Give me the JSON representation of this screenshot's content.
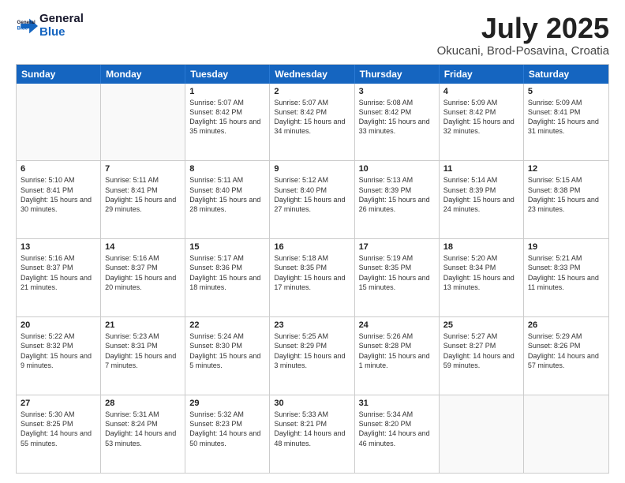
{
  "logo": {
    "text_general": "General",
    "text_blue": "Blue"
  },
  "title": "July 2025",
  "subtitle": "Okucani, Brod-Posavina, Croatia",
  "calendar": {
    "headers": [
      "Sunday",
      "Monday",
      "Tuesday",
      "Wednesday",
      "Thursday",
      "Friday",
      "Saturday"
    ],
    "weeks": [
      [
        {
          "day": "",
          "info": ""
        },
        {
          "day": "",
          "info": ""
        },
        {
          "day": "1",
          "info": "Sunrise: 5:07 AM\nSunset: 8:42 PM\nDaylight: 15 hours and 35 minutes."
        },
        {
          "day": "2",
          "info": "Sunrise: 5:07 AM\nSunset: 8:42 PM\nDaylight: 15 hours and 34 minutes."
        },
        {
          "day": "3",
          "info": "Sunrise: 5:08 AM\nSunset: 8:42 PM\nDaylight: 15 hours and 33 minutes."
        },
        {
          "day": "4",
          "info": "Sunrise: 5:09 AM\nSunset: 8:42 PM\nDaylight: 15 hours and 32 minutes."
        },
        {
          "day": "5",
          "info": "Sunrise: 5:09 AM\nSunset: 8:41 PM\nDaylight: 15 hours and 31 minutes."
        }
      ],
      [
        {
          "day": "6",
          "info": "Sunrise: 5:10 AM\nSunset: 8:41 PM\nDaylight: 15 hours and 30 minutes."
        },
        {
          "day": "7",
          "info": "Sunrise: 5:11 AM\nSunset: 8:41 PM\nDaylight: 15 hours and 29 minutes."
        },
        {
          "day": "8",
          "info": "Sunrise: 5:11 AM\nSunset: 8:40 PM\nDaylight: 15 hours and 28 minutes."
        },
        {
          "day": "9",
          "info": "Sunrise: 5:12 AM\nSunset: 8:40 PM\nDaylight: 15 hours and 27 minutes."
        },
        {
          "day": "10",
          "info": "Sunrise: 5:13 AM\nSunset: 8:39 PM\nDaylight: 15 hours and 26 minutes."
        },
        {
          "day": "11",
          "info": "Sunrise: 5:14 AM\nSunset: 8:39 PM\nDaylight: 15 hours and 24 minutes."
        },
        {
          "day": "12",
          "info": "Sunrise: 5:15 AM\nSunset: 8:38 PM\nDaylight: 15 hours and 23 minutes."
        }
      ],
      [
        {
          "day": "13",
          "info": "Sunrise: 5:16 AM\nSunset: 8:37 PM\nDaylight: 15 hours and 21 minutes."
        },
        {
          "day": "14",
          "info": "Sunrise: 5:16 AM\nSunset: 8:37 PM\nDaylight: 15 hours and 20 minutes."
        },
        {
          "day": "15",
          "info": "Sunrise: 5:17 AM\nSunset: 8:36 PM\nDaylight: 15 hours and 18 minutes."
        },
        {
          "day": "16",
          "info": "Sunrise: 5:18 AM\nSunset: 8:35 PM\nDaylight: 15 hours and 17 minutes."
        },
        {
          "day": "17",
          "info": "Sunrise: 5:19 AM\nSunset: 8:35 PM\nDaylight: 15 hours and 15 minutes."
        },
        {
          "day": "18",
          "info": "Sunrise: 5:20 AM\nSunset: 8:34 PM\nDaylight: 15 hours and 13 minutes."
        },
        {
          "day": "19",
          "info": "Sunrise: 5:21 AM\nSunset: 8:33 PM\nDaylight: 15 hours and 11 minutes."
        }
      ],
      [
        {
          "day": "20",
          "info": "Sunrise: 5:22 AM\nSunset: 8:32 PM\nDaylight: 15 hours and 9 minutes."
        },
        {
          "day": "21",
          "info": "Sunrise: 5:23 AM\nSunset: 8:31 PM\nDaylight: 15 hours and 7 minutes."
        },
        {
          "day": "22",
          "info": "Sunrise: 5:24 AM\nSunset: 8:30 PM\nDaylight: 15 hours and 5 minutes."
        },
        {
          "day": "23",
          "info": "Sunrise: 5:25 AM\nSunset: 8:29 PM\nDaylight: 15 hours and 3 minutes."
        },
        {
          "day": "24",
          "info": "Sunrise: 5:26 AM\nSunset: 8:28 PM\nDaylight: 15 hours and 1 minute."
        },
        {
          "day": "25",
          "info": "Sunrise: 5:27 AM\nSunset: 8:27 PM\nDaylight: 14 hours and 59 minutes."
        },
        {
          "day": "26",
          "info": "Sunrise: 5:29 AM\nSunset: 8:26 PM\nDaylight: 14 hours and 57 minutes."
        }
      ],
      [
        {
          "day": "27",
          "info": "Sunrise: 5:30 AM\nSunset: 8:25 PM\nDaylight: 14 hours and 55 minutes."
        },
        {
          "day": "28",
          "info": "Sunrise: 5:31 AM\nSunset: 8:24 PM\nDaylight: 14 hours and 53 minutes."
        },
        {
          "day": "29",
          "info": "Sunrise: 5:32 AM\nSunset: 8:23 PM\nDaylight: 14 hours and 50 minutes."
        },
        {
          "day": "30",
          "info": "Sunrise: 5:33 AM\nSunset: 8:21 PM\nDaylight: 14 hours and 48 minutes."
        },
        {
          "day": "31",
          "info": "Sunrise: 5:34 AM\nSunset: 8:20 PM\nDaylight: 14 hours and 46 minutes."
        },
        {
          "day": "",
          "info": ""
        },
        {
          "day": "",
          "info": ""
        }
      ]
    ]
  }
}
